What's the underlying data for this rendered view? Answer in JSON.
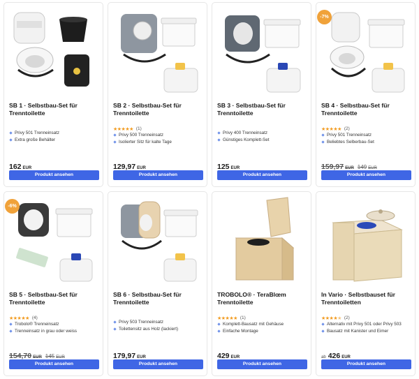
{
  "currency": "EUR",
  "button_label": "Produkt ansehen",
  "colors": {
    "accent": "#3f66e5",
    "badge": "#f0a23a",
    "star": "#f29a1d",
    "bullet": "#6c8fe8"
  },
  "products": [
    {
      "title": "SB 1 · Selbstbau-Set für Trenntoilette",
      "image_icon": "toilet-seat-bucket-tank-icon",
      "features": [
        "Privy 501 Trenneinsatz",
        "Extra große Behälter"
      ],
      "price": "162",
      "price_currency": "EUR"
    },
    {
      "title": "SB 2 · Selbstbau-Set für Trenntoilette",
      "image_icon": "separator-canister-icon",
      "rating": {
        "stars": 5,
        "count": "(1)"
      },
      "features": [
        "Privy 500 Trenneinsatz",
        "Isolierter Sitz für kalte Tage"
      ],
      "price": "129,97",
      "price_currency": "EUR"
    },
    {
      "title": "SB 3 · Selbstbau-Set für Trenntoilette",
      "image_icon": "separator-canister-icon",
      "features": [
        "Privy 400 Trenneinsatz",
        "Günstiges Komplett-Set"
      ],
      "price": "125",
      "price_currency": "EUR"
    },
    {
      "title": "SB 4 · Selbstbau-Set für Trenntoilette",
      "image_icon": "toilet-seat-canister-icon",
      "badge": "-7%",
      "rating": {
        "stars": 5,
        "count": "(2)"
      },
      "features": [
        "Privy 501 Trenneinsatz",
        "Beliebtes Selberbau-Set"
      ],
      "price": "159,97",
      "price_currency": "EUR",
      "price_old": true,
      "price_strike": "149",
      "price_strike_currency": "EUR"
    },
    {
      "title": "SB 5 · Selbstbau-Set für Trenntoilette",
      "image_icon": "separator-canister-icon",
      "badge": "-6%",
      "rating": {
        "stars": 5,
        "count": "(4)"
      },
      "features": [
        "Trobolo® Trenneinsatz",
        "Trenneinsatz in grau oder weiss"
      ],
      "price": "154,70",
      "price_currency": "EUR",
      "price_old": true,
      "price_strike": "145",
      "price_strike_currency": "EUR"
    },
    {
      "title": "SB 6 · Selbstbau-Set für Trenntoilette",
      "image_icon": "separator-canister-icon",
      "features": [
        "Privy 503 Trenneinsatz",
        "Toilettensitz aus Holz (lackiert)"
      ],
      "price": "179,97",
      "price_currency": "EUR"
    },
    {
      "title": "TROBOLO® · TeraBlœm Trenntoilette",
      "image_icon": "wooden-toilet-box-icon",
      "rating": {
        "stars": 5,
        "count": "(1)"
      },
      "features": [
        "Komplett-Bausatz mit Gehäuse",
        "Einfache Montage"
      ],
      "price": "429",
      "price_currency": "EUR"
    },
    {
      "title": "In Vario · Selbstbauset für Trenntoiletten",
      "image_icon": "wooden-toilet-box-icon",
      "rating": {
        "stars": 4.5,
        "count": "(2)"
      },
      "features": [
        "Alternativ mit Privy 501 oder Privy 503",
        "Bausatz mit Kanister und Eimer"
      ],
      "price_prefix": "ab",
      "price": "426",
      "price_currency": "EUR"
    }
  ]
}
